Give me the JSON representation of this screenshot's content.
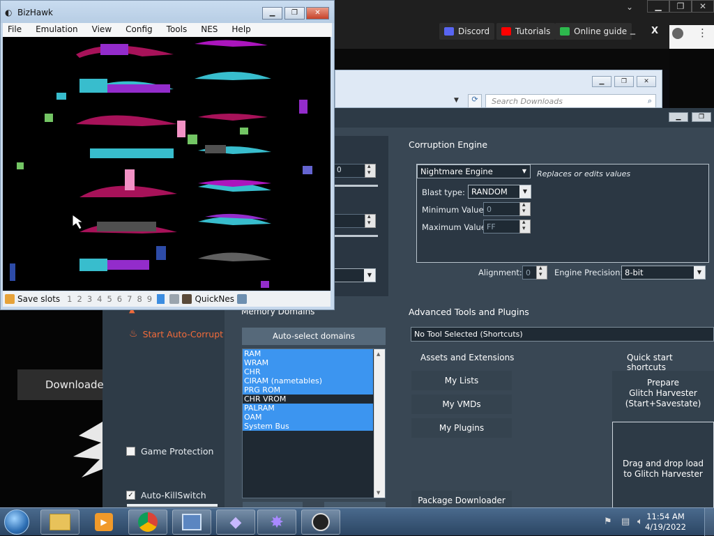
{
  "browser": {
    "toolbar": [
      {
        "label": "Discord",
        "color": "#5865f2"
      },
      {
        "label": "Tutorials",
        "color": "#ff0000"
      },
      {
        "label": "Online guide",
        "color": "#2db84d"
      }
    ],
    "minimize": "_",
    "close": "X",
    "menu": "⋮"
  },
  "explorer": {
    "search_placeholder": "Search Downloads"
  },
  "bizhawk": {
    "title": "BizHawk",
    "menu": [
      "File",
      "Emulation",
      "View",
      "Config",
      "Tools",
      "NES",
      "Help"
    ],
    "status": {
      "save_slots_label": "Save slots",
      "slots": [
        "1",
        "2",
        "3",
        "4",
        "5",
        "6",
        "7",
        "8",
        "9",
        "0"
      ],
      "core": "QuickNes"
    }
  },
  "rtc": {
    "left": {
      "start_auto_corrupt": "Start Auto-Corrupt",
      "game_protection": "Game Protection",
      "auto_killswitch": "Auto-KillSwitch",
      "auto_killswitch_checked": true,
      "game_protection_checked": false
    },
    "hidden_values": {
      "intensity_partial": "0"
    },
    "memory_domains": {
      "title": "Memory Domains",
      "auto_select": "Auto-select domains",
      "items": [
        {
          "label": "RAM",
          "selected": true
        },
        {
          "label": "WRAM",
          "selected": true
        },
        {
          "label": "CHR",
          "selected": true
        },
        {
          "label": "CIRAM (nametables)",
          "selected": true
        },
        {
          "label": "PRG ROM",
          "selected": true
        },
        {
          "label": "CHR VROM",
          "selected": false
        },
        {
          "label": "PALRAM",
          "selected": true
        },
        {
          "label": "OAM",
          "selected": true
        },
        {
          "label": "System Bus",
          "selected": true
        }
      ]
    },
    "corruption_engine": {
      "title": "Corruption Engine",
      "engine": "Nightmare Engine",
      "engine_desc": "Replaces or edits values",
      "blast_type_label": "Blast type:",
      "blast_type": "RANDOM",
      "min_label": "Minimum Value",
      "min_value": "0",
      "max_label": "Maximum Value",
      "max_value": "FF",
      "alignment_label": "Alignment:",
      "alignment": "0",
      "precision_label": "Engine Precision:",
      "precision": "8-bit"
    },
    "advanced": {
      "title": "Advanced Tools and Plugins",
      "tool_select": "No Tool Selected (Shortcuts)",
      "assets_label": "Assets and Extensions",
      "quick_label": "Quick start shortcuts",
      "buttons": [
        "My Lists",
        "My VMDs",
        "My Plugins"
      ],
      "package_downloader": "Package Downloader",
      "prepare": [
        "Prepare",
        "Glitch Harvester",
        "(Start+Savestate)"
      ],
      "dropzone": [
        "Drag and drop load",
        "to Glitch Harvester"
      ]
    }
  },
  "downloads_panel": {
    "button": "Downloade"
  },
  "taskbar": {
    "time": "11:54 AM",
    "date": "4/19/2022"
  }
}
